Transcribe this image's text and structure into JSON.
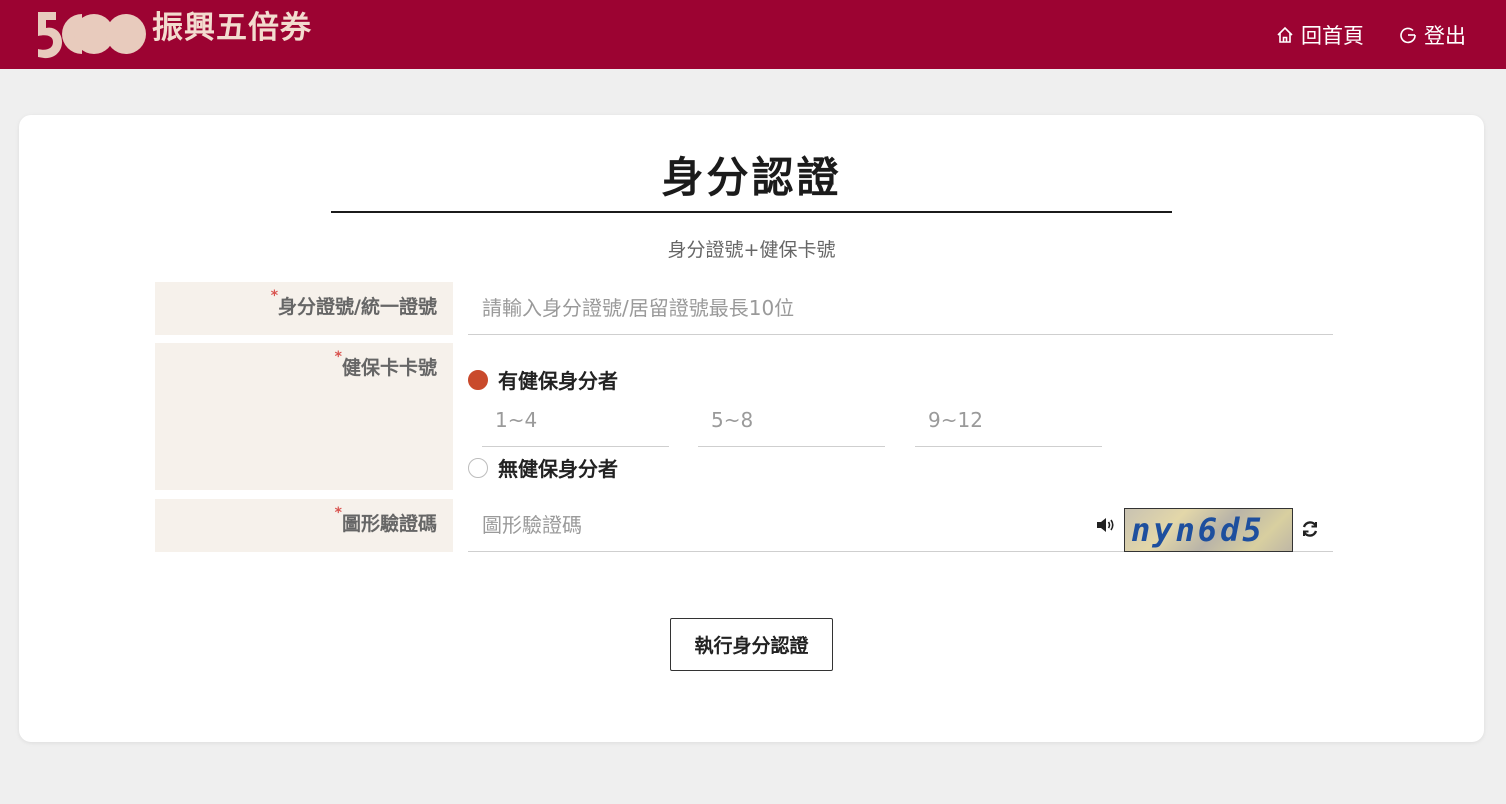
{
  "header": {
    "logo_text": "振興五倍券",
    "logo_mark": "5000-logo",
    "nav": [
      {
        "label": "回首頁",
        "icon": "home-icon"
      },
      {
        "label": "登出",
        "icon": "logout-icon"
      }
    ],
    "colors": {
      "bar": "#9c0332",
      "logo": "#f3dccf"
    }
  },
  "page": {
    "title": "身分認證",
    "subtitle": "身分證號+健保卡號"
  },
  "form": {
    "required_mark": "*",
    "id_field": {
      "label": "身分證號/統一證號",
      "placeholder": "請輸入身分證號/居留證號最長10位",
      "value": ""
    },
    "card_field": {
      "label": "健保卡卡號",
      "option_has": "有健保身分者",
      "option_none": "無健保身分者",
      "selected": "有健保身分者",
      "segments": [
        {
          "placeholder": "1~4",
          "value": ""
        },
        {
          "placeholder": "5~8",
          "value": ""
        },
        {
          "placeholder": "9~12",
          "value": ""
        }
      ]
    },
    "captcha_field": {
      "label": "圖形驗證碼",
      "placeholder": "圖形驗證碼",
      "value": "",
      "captcha_text": "nyn6d5"
    },
    "submit_label": "執行身分認證"
  },
  "colors": {
    "accent": "#c94a2c",
    "label_bg": "#f6f1eb"
  }
}
